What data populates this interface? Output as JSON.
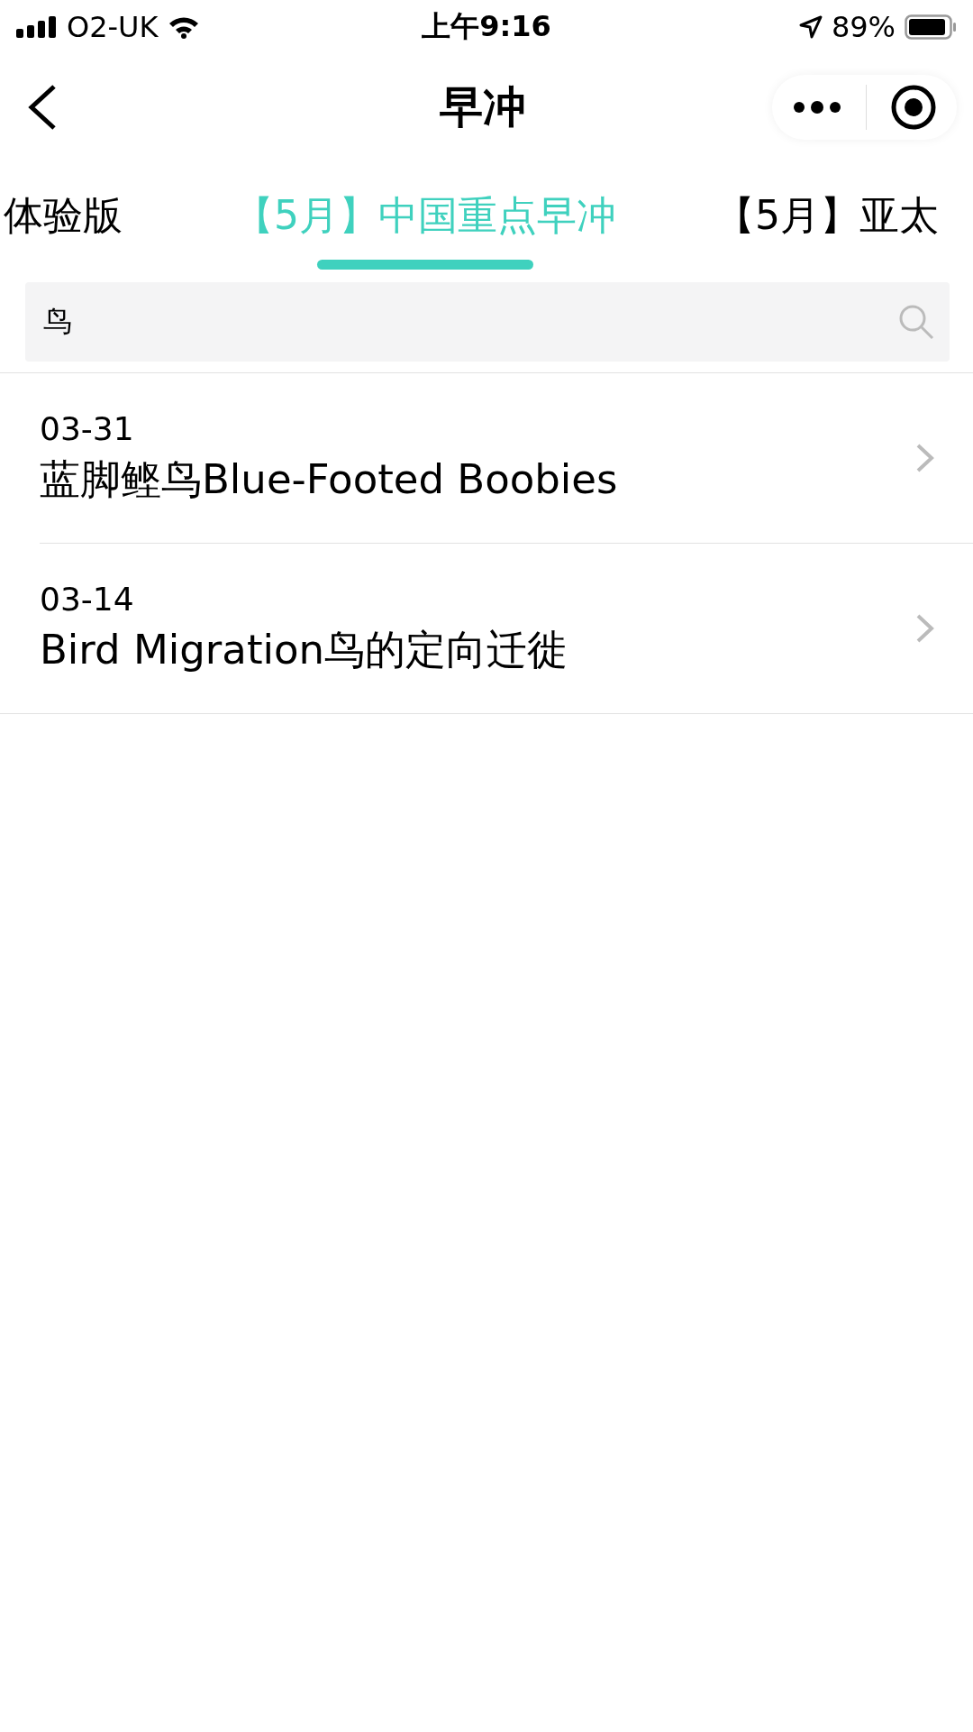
{
  "status_bar": {
    "carrier": "O2-UK",
    "time": "上午9:16",
    "battery": "89%"
  },
  "nav": {
    "title": "早冲"
  },
  "tabs": [
    {
      "label": "体验版",
      "selected": false
    },
    {
      "label": "【5月】中国重点早冲",
      "selected": true
    },
    {
      "label": "【5月】亚太",
      "selected": false
    }
  ],
  "search": {
    "value": "鸟"
  },
  "results": [
    {
      "date": "03-31",
      "title": "蓝脚鲣鸟Blue-Footed Boobies"
    },
    {
      "date": "03-14",
      "title": "Bird Migration鸟的定向迁徙"
    }
  ]
}
